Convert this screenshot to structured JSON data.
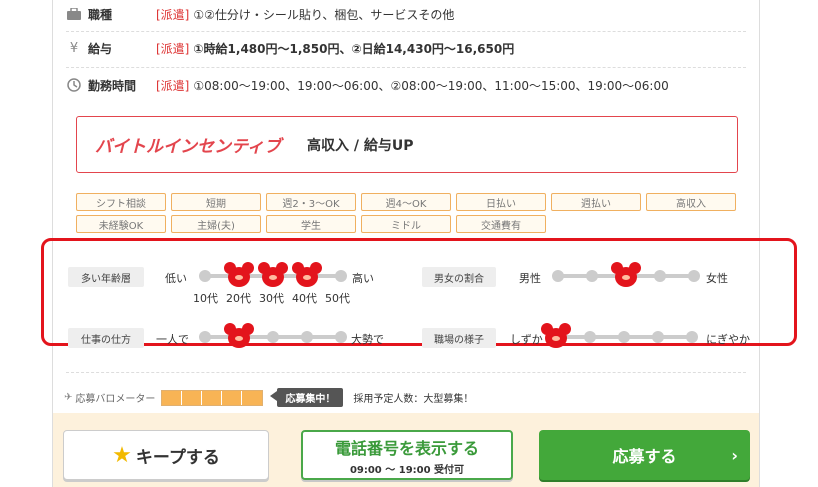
{
  "job": {
    "type": {
      "label": "職種",
      "tag": "[派遣]",
      "value": "①②仕分け・シール貼り、梱包、サービスその他"
    },
    "pay": {
      "label": "給与",
      "tag": "[派遣]",
      "value": "①時給1,480円〜1,850円、②日給14,430円〜16,650円"
    },
    "hours": {
      "label": "勤務時間",
      "tag": "[派遣]",
      "value": "①08:00〜19:00、19:00〜06:00、②08:00〜19:00、11:00〜15:00、19:00〜06:00"
    }
  },
  "incentive": {
    "logo": "バイトルインセンティブ",
    "text": "高収入 / 給与UP"
  },
  "tags": [
    "シフト相談",
    "短期",
    "週2・3〜OK",
    "週4〜OK",
    "日払い",
    "週払い",
    "高収入",
    "未経験OK",
    "主婦(夫)",
    "学生",
    "ミドル",
    "交通費有"
  ],
  "sliders": {
    "age": {
      "label": "多い年齢層",
      "left": "低い",
      "right": "高い",
      "ticks": [
        "10代",
        "20代",
        "30代",
        "40代",
        "50代"
      ],
      "selected": [
        1,
        2,
        3
      ]
    },
    "gender": {
      "label": "男女の割合",
      "left": "男性",
      "right": "女性",
      "selected": [
        2
      ]
    },
    "work_style": {
      "label": "仕事の仕方",
      "left": "一人で",
      "right": "大勢で",
      "selected": [
        1
      ]
    },
    "atmosphere": {
      "label": "職場の様子",
      "left": "しずか",
      "right": "にぎやか",
      "selected": [
        0
      ]
    }
  },
  "barometer": {
    "label": "応募バロメーター",
    "level": 5,
    "badge": "応募集中！",
    "note": "採用予定人数：大型募集！"
  },
  "buttons": {
    "keep": "キープする",
    "tel_main": "電話番号を表示する",
    "tel_sub": "09:00 〜 19:00 受付可",
    "apply": "応募する"
  },
  "colors": {
    "accent": "#e3141c",
    "green": "#43a83a",
    "orange": "#f8b455"
  }
}
